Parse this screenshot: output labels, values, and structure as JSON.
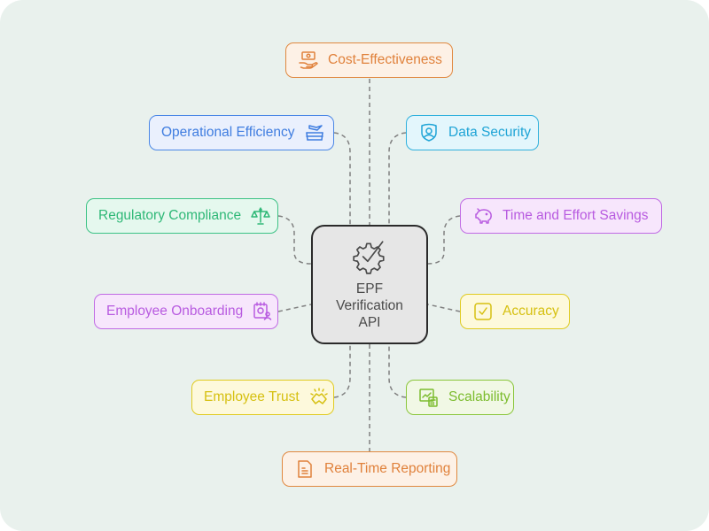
{
  "diagram": {
    "type": "hub-and-spoke",
    "center": {
      "icon": "gear-check-icon",
      "lines": [
        "EPF",
        "Verification",
        "API"
      ]
    },
    "nodes": [
      {
        "id": "cost-effectiveness",
        "label": "Cost-Effectiveness",
        "icon": "money-hand-icon",
        "color": "#e0813b"
      },
      {
        "id": "operational-efficiency",
        "label": "Operational Efficiency",
        "icon": "conveyor-icon",
        "color": "#3f7de0"
      },
      {
        "id": "data-security",
        "label": "Data Security",
        "icon": "shield-user-icon",
        "color": "#1fa4d6"
      },
      {
        "id": "regulatory-compliance",
        "label": "Regulatory Compliance",
        "icon": "scales-icon",
        "color": "#2fb877"
      },
      {
        "id": "time-and-effort-savings",
        "label": "Time and Effort Savings",
        "icon": "piggy-bank-icon",
        "color": "#b85be0"
      },
      {
        "id": "employee-onboarding",
        "label": "Employee Onboarding",
        "icon": "calendar-user-icon",
        "color": "#b85be0"
      },
      {
        "id": "accuracy",
        "label": "Accuracy",
        "icon": "checkbox-icon",
        "color": "#d6c011"
      },
      {
        "id": "employee-trust",
        "label": "Employee Trust",
        "icon": "handshake-icon",
        "color": "#d6c011"
      },
      {
        "id": "scalability",
        "label": "Scalability",
        "icon": "chart-calculator-icon",
        "color": "#7cbc2e"
      },
      {
        "id": "real-time-reporting",
        "label": "Real-Time Reporting",
        "icon": "document-icon",
        "color": "#e0813b"
      }
    ],
    "connector_color": "#808080",
    "background": "#e9f1ed"
  }
}
